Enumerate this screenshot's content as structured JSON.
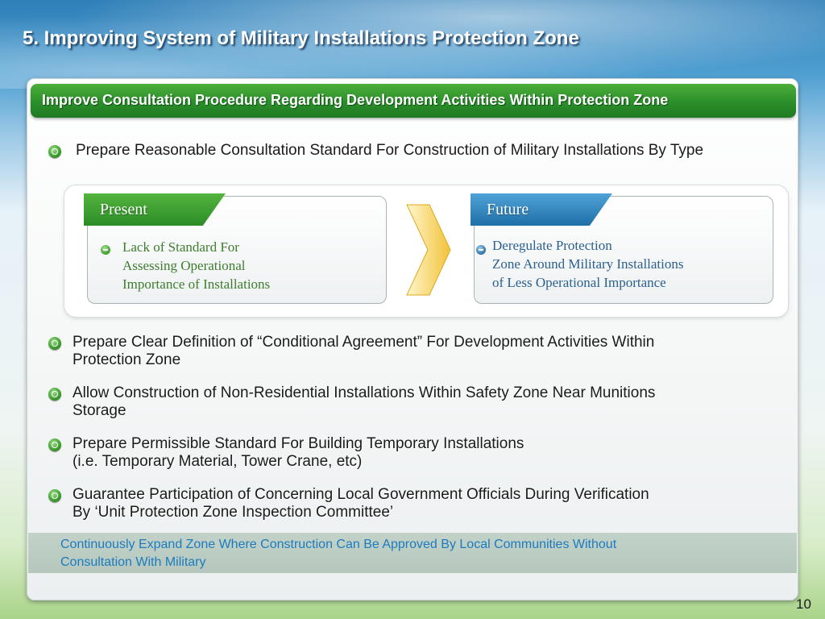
{
  "slide": {
    "title": "5. Improving System of Military Installations Protection Zone",
    "page_number": "10"
  },
  "panel": {
    "header": "Improve Consultation Procedure Regarding Development Activities Within Protection Zone"
  },
  "first_bullet": {
    "icon": "bullet-icon",
    "text": "Prepare Reasonable Consultation Standard For Construction of Military Installations By Type"
  },
  "comparison": {
    "present": {
      "label": "Present",
      "color": "#2c8d28",
      "text": "Lack of Standard For\nAssessing Operational\nImportance of Installations"
    },
    "future": {
      "label": "Future",
      "color": "#1f6fa8",
      "text": "Deregulate Protection\nZone Around Military Installations\nof Less Operational Importance"
    },
    "arrow_color": "#f2c23a"
  },
  "bullets": [
    {
      "line1": "Prepare Clear Definition of “Conditional Agreement” For Development Activities Within",
      "line2": "Protection Zone"
    },
    {
      "line1": "Allow Construction of Non-Residential Installations Within Safety Zone Near Munitions",
      "line2": "Storage"
    },
    {
      "line1": "Prepare Permissible Standard For Building Temporary Installations",
      "line2": "(i.e. Temporary Material, Tower Crane, etc)"
    },
    {
      "line1": "Guarantee Participation of Concerning Local Government Officials During Verification",
      "line2": "By ‘Unit Protection Zone Inspection Committee’"
    }
  ],
  "summary": {
    "line1": "Continuously Expand Zone Where Construction Can Be Approved By Local Communities Without",
    "line2": "Consultation With Military"
  }
}
